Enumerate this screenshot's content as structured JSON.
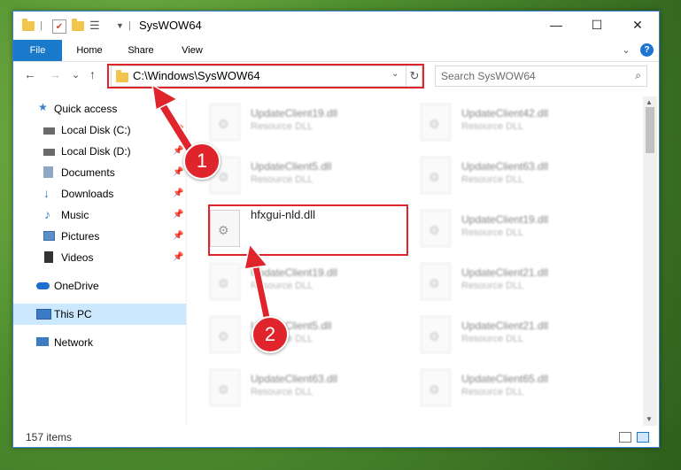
{
  "window": {
    "title": "SysWOW64",
    "controls": {
      "minimize": "—",
      "maximize": "☐",
      "close": "✕"
    }
  },
  "ribbon": {
    "tabs": [
      "File",
      "Home",
      "Share",
      "View"
    ],
    "expand_glyph": "⌄",
    "help_glyph": "?"
  },
  "nav": {
    "back": "←",
    "forward": "→",
    "recent": "⌄",
    "up": "↑",
    "address": "C:\\Windows\\SysWOW64",
    "address_dropdown": "⌄",
    "refresh": "↻",
    "search_placeholder": "Search SysWOW64",
    "search_icon": "⌕"
  },
  "sidebar": {
    "items": [
      {
        "label": "Quick access",
        "icon": "star-icon",
        "color": "#3c7fc7",
        "pin": ""
      },
      {
        "label": "Local Disk (C:)",
        "icon": "drive-icon",
        "color": "#6a6a6a",
        "pin": "📌"
      },
      {
        "label": "Local Disk (D:)",
        "icon": "drive-icon",
        "color": "#6a6a6a",
        "pin": "📌"
      },
      {
        "label": "Documents",
        "icon": "documents-icon",
        "color": "#8fa7c4",
        "pin": "📌"
      },
      {
        "label": "Downloads",
        "icon": "downloads-icon",
        "color": "#2f7fd6",
        "pin": "📌"
      },
      {
        "label": "Music",
        "icon": "music-icon",
        "color": "#2f7fd6",
        "pin": "📌"
      },
      {
        "label": "Pictures",
        "icon": "pictures-icon",
        "color": "#5b8fc9",
        "pin": "📌"
      },
      {
        "label": "Videos",
        "icon": "videos-icon",
        "color": "#333333",
        "pin": "📌"
      },
      {
        "label": "OneDrive",
        "icon": "onedrive-icon",
        "color": "#1d6fd1",
        "pin": ""
      },
      {
        "label": "This PC",
        "icon": "this-pc-icon",
        "color": "#3b7bc4",
        "pin": ""
      },
      {
        "label": "Network",
        "icon": "network-icon",
        "color": "#3b7bc4",
        "pin": ""
      }
    ]
  },
  "files": [
    {
      "name": "UpdateClient19.dll",
      "type": "Resource DLL"
    },
    {
      "name": "UpdateClient42.dll",
      "type": "Resource DLL"
    },
    {
      "name": "UpdateClient5.dll",
      "type": "Resource DLL"
    },
    {
      "name": "UpdateClient63.dll",
      "type": "Resource DLL"
    },
    {
      "name": "hfxgui-nld.dll",
      "type": ""
    },
    {
      "name": "UpdateClient19.dll",
      "type": "Resource DLL"
    },
    {
      "name": "UpdateClient19.dll",
      "type": "Resource DLL"
    },
    {
      "name": "UpdateClient21.dll",
      "type": "Resource DLL"
    },
    {
      "name": "UpdateClient5.dll",
      "type": "Resource DLL"
    },
    {
      "name": "UpdateClient21.dll",
      "type": "Resource DLL"
    },
    {
      "name": "UpdateClient63.dll",
      "type": "Resource DLL"
    },
    {
      "name": "UpdateClient65.dll",
      "type": "Resource DLL"
    }
  ],
  "status": {
    "item_count": "157 items"
  },
  "annotations": {
    "step1": "1",
    "step2": "2",
    "accent": "#e0242b"
  }
}
